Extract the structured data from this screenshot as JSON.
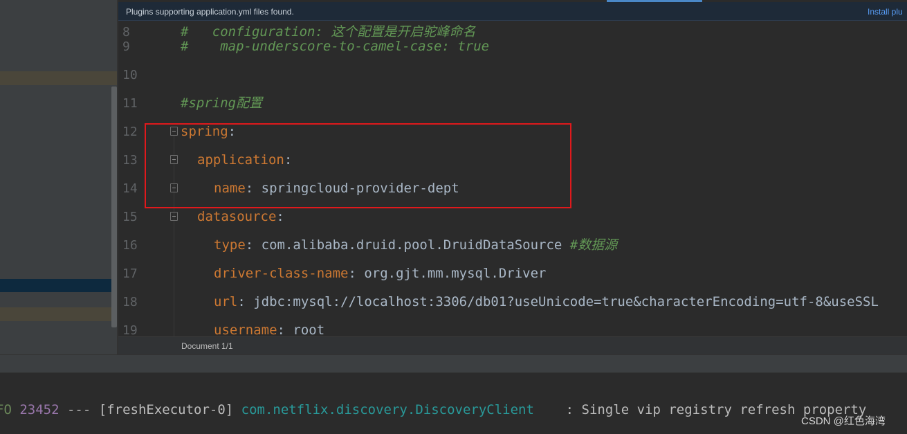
{
  "banner": {
    "message": "Plugins supporting application.yml files found.",
    "action": "Install plu"
  },
  "editor": {
    "lines": [
      {
        "num": "8",
        "text": "#   configuration: 这个配置是开启驼峰命名"
      },
      {
        "num": "9",
        "text": "#    map-underscore-to-camel-case: true"
      },
      {
        "num": "10",
        "text": ""
      },
      {
        "num": "11",
        "text": "#spring配置"
      },
      {
        "num": "12",
        "key": "spring",
        "sep": ":"
      },
      {
        "num": "13",
        "key": "application",
        "sep": ":"
      },
      {
        "num": "14",
        "key": "name",
        "sep": ": ",
        "value": "springcloud-provider-dept"
      },
      {
        "num": "15",
        "key": "datasource",
        "sep": ":"
      },
      {
        "num": "16",
        "key": "type",
        "sep": ": ",
        "value": "com.alibaba.druid.pool.DruidDataSource ",
        "comment": "#数据源"
      },
      {
        "num": "17",
        "key": "driver-class-name",
        "sep": ": ",
        "value": "org.gjt.mm.mysql.Driver"
      },
      {
        "num": "18",
        "key": "url",
        "sep": ": ",
        "value": "jdbc:mysql://localhost:3306/db01?useUnicode=true&characterEncoding=utf-8&useSSL"
      },
      {
        "num": "19",
        "key": "username",
        "sep": ": ",
        "value": "root"
      }
    ]
  },
  "breadcrumb": "Document 1/1",
  "console": {
    "level": "FO",
    "pid": "23452",
    "dashes": " --- ",
    "thread": "[freshExecutor-0] ",
    "logger": "com.netflix.discovery.DiscoveryClient",
    "message": "    : Single vip registry refresh property",
    "line2": "   ...        [            ]                                                         "
  },
  "watermark": "CSDN @红色海湾",
  "colors": {
    "key": "#cc7832",
    "comment": "#629755",
    "highlight_box": "#e0191c",
    "banner_link": "#589df6"
  }
}
